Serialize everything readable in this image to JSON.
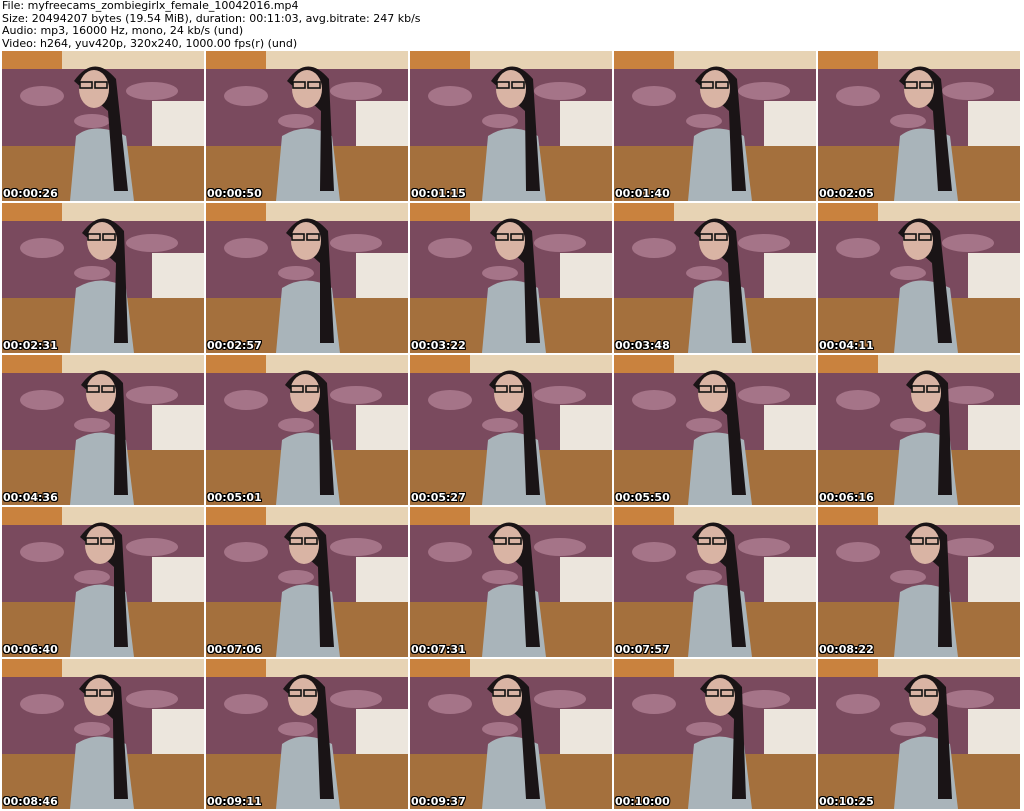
{
  "header": {
    "file_line": "File: myfreecams_zombiegirlx_female_10042016.mp4",
    "size_line": "Size: 20494207 bytes (19.54 MiB), duration: 00:11:03, avg.bitrate: 247 kb/s",
    "audio_line": "Audio: mp3, 16000 Hz, mono, 24 kb/s (und)",
    "video_line": "Video: h264, yuv420p, 320x240, 1000.00 fps(r) (und)"
  },
  "thumbnails": [
    {
      "time": "00:00:26"
    },
    {
      "time": "00:00:50"
    },
    {
      "time": "00:01:15"
    },
    {
      "time": "00:01:40"
    },
    {
      "time": "00:02:05"
    },
    {
      "time": "00:02:31"
    },
    {
      "time": "00:02:57"
    },
    {
      "time": "00:03:22"
    },
    {
      "time": "00:03:48"
    },
    {
      "time": "00:04:11"
    },
    {
      "time": "00:04:36"
    },
    {
      "time": "00:05:01"
    },
    {
      "time": "00:05:27"
    },
    {
      "time": "00:05:50"
    },
    {
      "time": "00:06:16"
    },
    {
      "time": "00:06:40"
    },
    {
      "time": "00:07:06"
    },
    {
      "time": "00:07:31"
    },
    {
      "time": "00:07:57"
    },
    {
      "time": "00:08:22"
    },
    {
      "time": "00:08:46"
    },
    {
      "time": "00:09:11"
    },
    {
      "time": "00:09:37"
    },
    {
      "time": "00:10:00"
    },
    {
      "time": "00:10:25"
    }
  ],
  "colors": {
    "wall": "#e7d3b4",
    "door": "#c9823e",
    "bedspread": "#7a4a5e",
    "bedspread_light": "#a57488",
    "floor": "#a4703d",
    "dresser": "#ece6dd",
    "shirt": "#a9b4ba",
    "hair": "#1a1416",
    "skin": "#d9b4a4"
  }
}
